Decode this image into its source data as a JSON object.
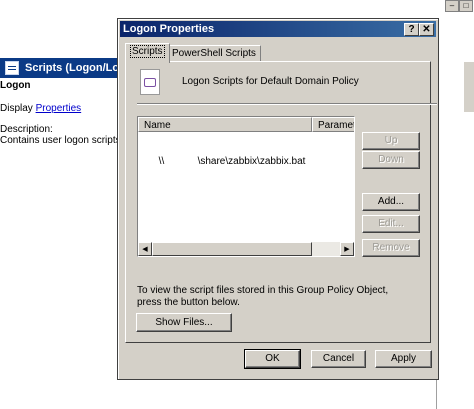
{
  "background": {
    "header_title": "Scripts (Logon/Logoff)",
    "section_title": "Logon",
    "display_label": "Display",
    "display_link": "Properties",
    "description_label": "Description:",
    "description_text": "Contains user logon scripts."
  },
  "dialog": {
    "title": "Logon Properties",
    "help_glyph": "?",
    "close_glyph": "✕",
    "tabs": [
      {
        "label": "Scripts",
        "active": true
      },
      {
        "label": "PowerShell Scripts",
        "active": false
      }
    ],
    "heading": "Logon Scripts for Default Domain Policy",
    "list": {
      "columns": [
        "Name",
        "Parameters"
      ],
      "rows": [
        {
          "name": "\\\\            \\share\\zabbix\\zabbix.bat",
          "parameters": ""
        }
      ]
    },
    "side_buttons": {
      "up": "Up",
      "down": "Down",
      "add": "Add...",
      "edit": "Edit...",
      "remove": "Remove"
    },
    "info_text": "To view the script files stored in this Group Policy Object, press the button below.",
    "show_files": "Show Files...",
    "footer": {
      "ok": "OK",
      "cancel": "Cancel",
      "apply": "Apply"
    }
  }
}
